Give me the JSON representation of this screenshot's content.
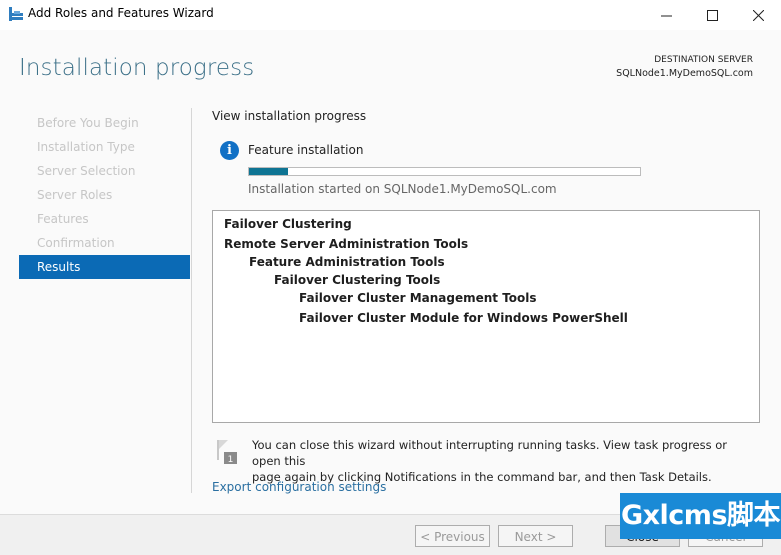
{
  "window": {
    "title": "Add Roles and Features Wizard",
    "controls": {
      "minimize": "—",
      "maximize": "☐",
      "close": "✕"
    }
  },
  "header": {
    "page_title": "Installation progress",
    "destination_label": "DESTINATION SERVER",
    "destination_server": "SQLNode1.MyDemoSQL.com"
  },
  "nav": {
    "items": [
      {
        "label": "Before You Begin",
        "active": false
      },
      {
        "label": "Installation Type",
        "active": false
      },
      {
        "label": "Server Selection",
        "active": false
      },
      {
        "label": "Server Roles",
        "active": false
      },
      {
        "label": "Features",
        "active": false
      },
      {
        "label": "Confirmation",
        "active": false
      },
      {
        "label": "Results",
        "active": true
      }
    ]
  },
  "main": {
    "section_title": "View installation progress",
    "info_icon": "i",
    "feature_label": "Feature installation",
    "progress_percent": 10,
    "started_text": "Installation started on SQLNode1.MyDemoSQL.com",
    "results": [
      {
        "text": "Failover Clustering",
        "level": 0
      },
      {
        "text": "Remote Server Administration Tools",
        "level": 0
      },
      {
        "text": "Feature Administration Tools",
        "level": 1
      },
      {
        "text": "Failover Clustering Tools",
        "level": 2
      },
      {
        "text": "Failover Cluster Management Tools",
        "level": 3
      },
      {
        "text": "Failover Cluster Module for Windows PowerShell",
        "level": 3
      }
    ],
    "note_badge": "1",
    "note_line1": "You can close this wizard without interrupting running tasks. View task progress or open this",
    "note_line2": "page again by clicking Notifications in the command bar, and then Task Details.",
    "export_link": "Export configuration settings"
  },
  "footer": {
    "previous": "< Previous",
    "next": "Next >",
    "close": "Close",
    "cancel": "Cancel"
  },
  "watermark": "Gxlcms脚本",
  "colors": {
    "accent": "#0b6ab5",
    "progress": "#0e7493",
    "title": "#3c7088",
    "link": "#2a6fa1"
  }
}
